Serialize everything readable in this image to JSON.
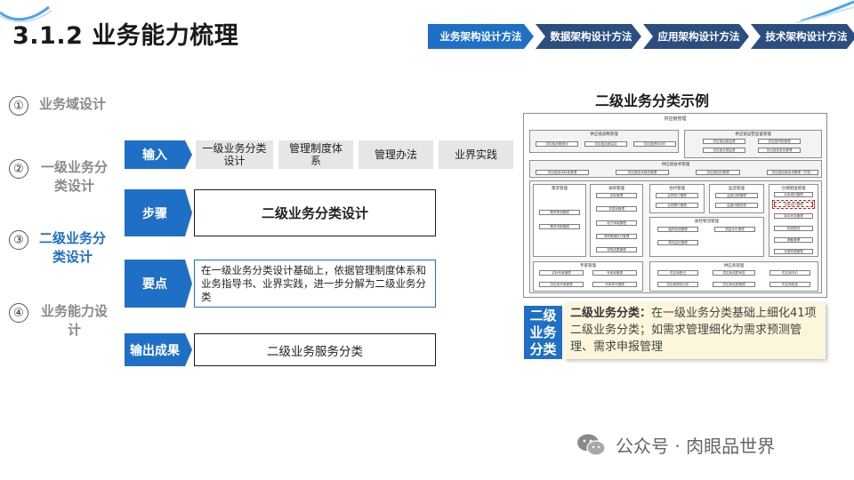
{
  "title": "3.1.2 业务能力梳理",
  "nav": [
    "业务架构设计方法",
    "数据架构设计方法",
    "应用架构设计方法",
    "技术架构设计方法"
  ],
  "phases": [
    {
      "num": "①",
      "label": "业务域设计"
    },
    {
      "num": "②",
      "label_line1": "一级业务分",
      "label_line2": "类设计"
    },
    {
      "num": "③",
      "label_line1": "二级业务分",
      "label_line2": "类设计"
    },
    {
      "num": "④",
      "label_line1": "业务能力设",
      "label_line2": "计"
    }
  ],
  "flow": {
    "input_tag": "输入",
    "inputs": [
      {
        "line1": "一级业务分类",
        "line2": "设计"
      },
      {
        "line1": "管理制度体",
        "line2": "系"
      },
      {
        "line1": "管理办法",
        "line2": ""
      },
      {
        "line1": "业界实践",
        "line2": ""
      }
    ],
    "step_tag": "步骤",
    "step_text": "二级业务分类设计",
    "key_tag": "要点",
    "key_text": "在一级业务分类设计基础上，依据管理制度体系和业务指导书、业界实践，进一步分解为二级业务分类",
    "output_tag": "输出成果",
    "output_text": "二级业务服务分类"
  },
  "example": {
    "title": "二级业务分类示例",
    "diagram_title": "供应链管理",
    "groups": {
      "g1": {
        "title": "供应链战略管理",
        "items": [
          "供应链战略规划",
          "供应链运营监控",
          "供应链绩效评价"
        ]
      },
      "g2": {
        "title": "供应链运营监督管理",
        "items": [
          "供应链运营监督",
          "供应链风险管理",
          "供应链合规监督",
          "供应链信息化管理"
        ]
      },
      "g3": {
        "title": "供应链技术管理",
        "items": [
          "供应链技术标准管理",
          "供应链技术规范管理",
          "供应链知识管理",
          "供应链创新技术管理（开发）"
        ]
      },
      "g4": {
        "title": "需求管理",
        "items": [
          "需求预测管理",
          "需求申报管理"
        ]
      },
      "g5": {
        "title": "采购管理",
        "items": [
          "招标管理",
          "非招标管理",
          "电子商城管理",
          "采购策略执行管理",
          "采购成果管理"
        ]
      },
      "g6": {
        "title": "合约管理",
        "items": [
          "合同签订管理",
          "合同履行管理"
        ]
      },
      "g7": {
        "title": "监造管理",
        "items": [
          "监造过程管理",
          "监造问题处理"
        ]
      },
      "g8": {
        "title": "仓储配送管理",
        "items": [
          "仓库规划管理",
          "仓库运行管理",
          "库存状态管理",
          "物资配送",
          "储备管理",
          "仓储资源管理"
        ]
      },
      "g9": {
        "title": "质检物流管理",
        "items": [
          "抽样检测管理",
          "质量评价管理",
          "物流监控管理"
        ]
      },
      "g10": {
        "title": "专家管理",
        "items": [
          "评标专家管理",
          "专家库管理",
          "供应商专家管理",
          "专家考评管理"
        ]
      },
      "g11": {
        "title": "供应商管理",
        "items": [
          "供应商登记",
          "供应商资质审查",
          "供应商评价",
          "供应商绩效分析",
          "供应商信用管理",
          "供应商奖惩"
        ]
      }
    },
    "side_tag": "二级业务分类",
    "note_bold": "二级业务分类：",
    "note_text": "在一级业务分类基础上细化41项二级业务分类；如需求管理细化为需求预测管理、需求申报管理"
  },
  "footer": {
    "text": "公众号 · 肉眼品世界",
    "icon": "wechat-icon"
  },
  "colors": {
    "accent": "#1f6fc6",
    "nav_dark": "#2b4e7f",
    "note_bg": "#fbf6dc"
  }
}
